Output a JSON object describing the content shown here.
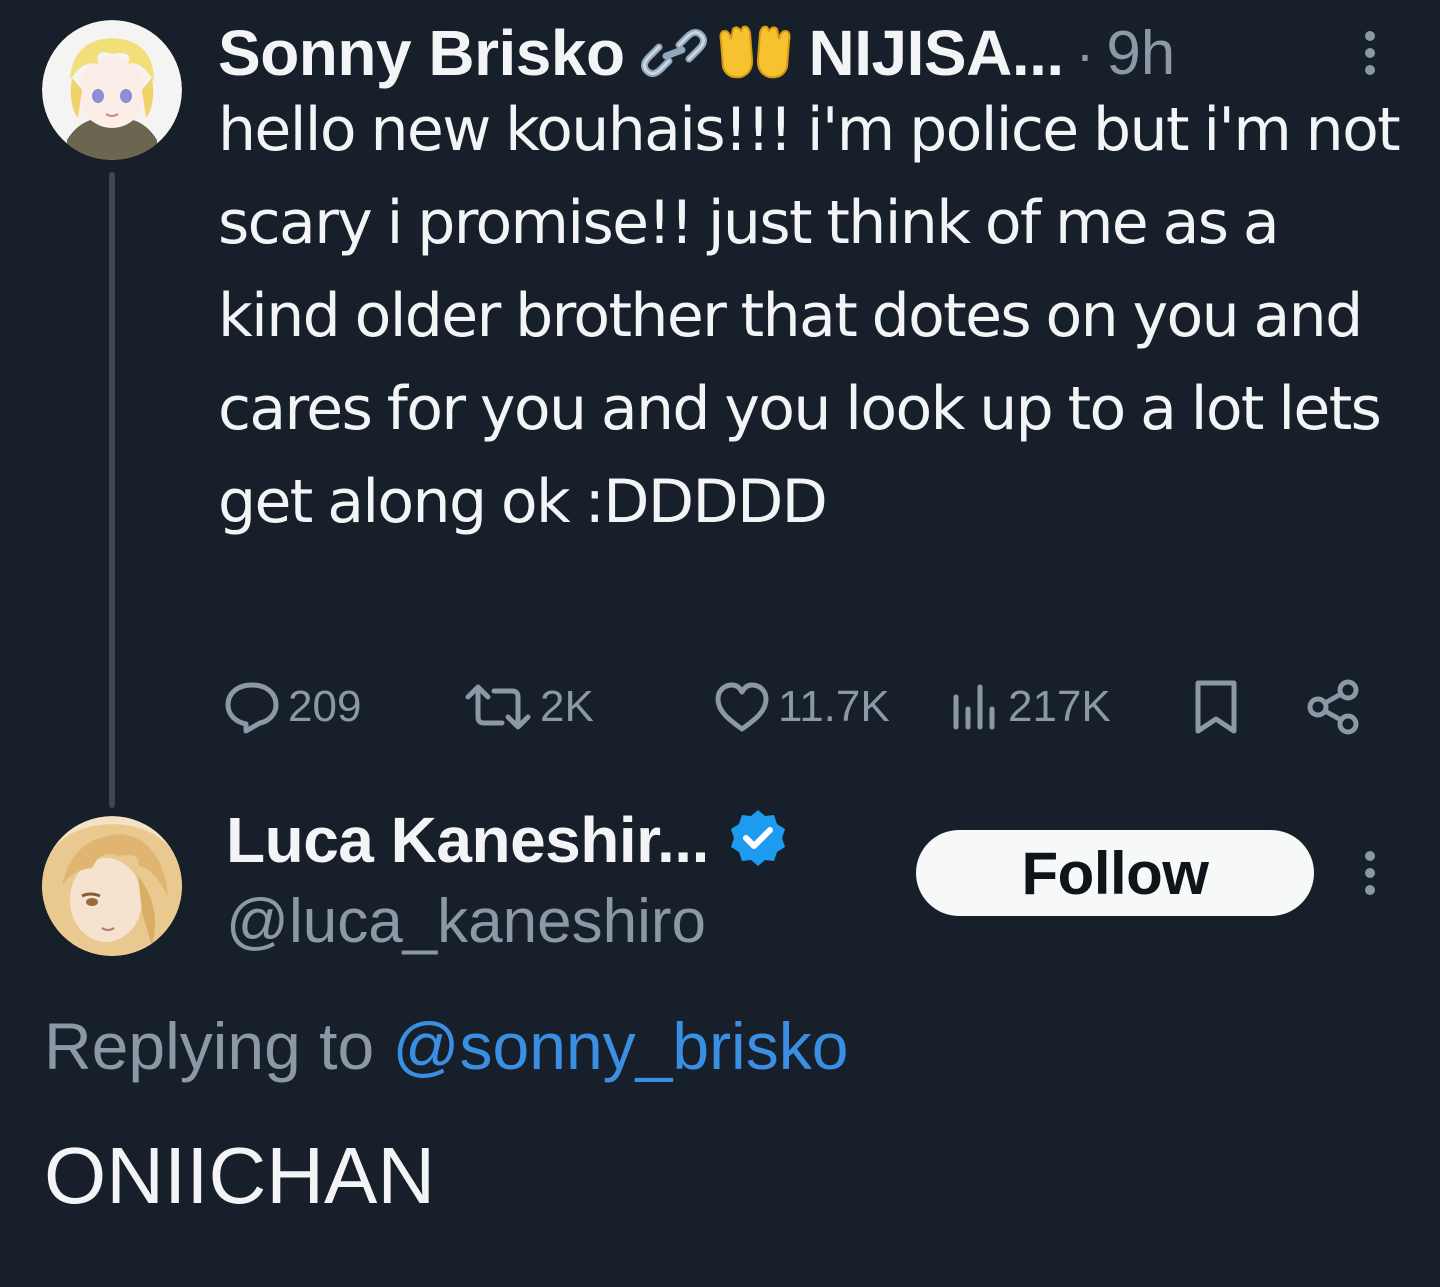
{
  "tweet": {
    "author_name": "Sonny Brisko",
    "author_suffix": "NIJISA...",
    "separator": "·",
    "time": "9h",
    "emojis": [
      "link-emoji",
      "palms-up-emoji"
    ],
    "text": "hello new kouhais!!! i'm police but i'm not scary i promise!! just think of me as a kind older brother that dotes on you and cares for you and you look up to a lot lets get along ok :DDDDD",
    "replies": "209",
    "retweets": "2K",
    "likes": "11.7K",
    "views": "217K"
  },
  "reply": {
    "author_name": "Luca Kaneshir...",
    "handle": "@luca_kaneshiro",
    "verified": true,
    "follow_label": "Follow",
    "replying_prefix": "Replying to",
    "replying_to": "@sonny_brisko",
    "text": "ONIICHAN"
  },
  "colors": {
    "background": "#171f2a",
    "text": "#f2f4f5",
    "muted": "#8b98a5",
    "link": "#3b8fe3",
    "verified": "#1d9bf0"
  }
}
